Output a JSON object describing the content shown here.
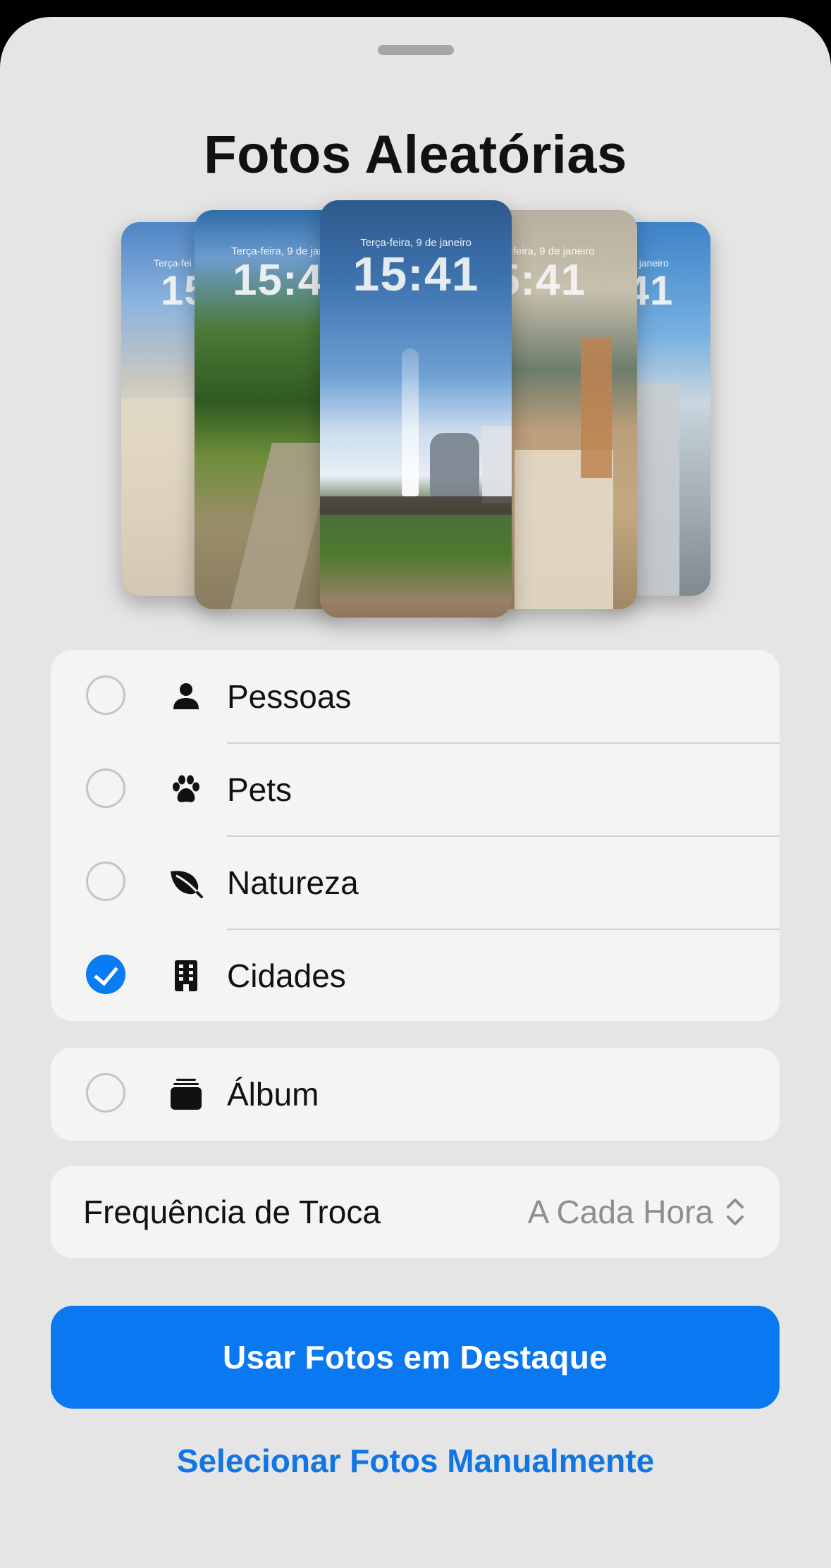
{
  "title": "Fotos Aleatórias",
  "previews": {
    "date_partial_left": "Terça-fei",
    "date_left": "Terça-feira, 9 de janeir",
    "date_center": "Terça-feira, 9 de janeiro",
    "date_right": "a-feira, 9 de janeiro",
    "date_far_right": "de janeiro",
    "time_far_left": "15",
    "time_left": "15:4",
    "time_center": "15:41",
    "time_right": "5:41",
    "time_far_right": "41"
  },
  "categories": [
    {
      "label": "Pessoas",
      "icon": "person-icon",
      "selected": false
    },
    {
      "label": "Pets",
      "icon": "paw-icon",
      "selected": false
    },
    {
      "label": "Natureza",
      "icon": "leaf-icon",
      "selected": false
    },
    {
      "label": "Cidades",
      "icon": "building-icon",
      "selected": true
    }
  ],
  "album": {
    "label": "Álbum",
    "icon": "album-stack-icon",
    "selected": false
  },
  "frequency": {
    "label": "Frequência de Troca",
    "value": "A Cada Hora"
  },
  "primary_button": "Usar Fotos em Destaque",
  "secondary_button": "Selecionar Fotos Manualmente",
  "colors": {
    "accent": "#0a78f0",
    "link": "#1175e4",
    "background": "#e5e5e6",
    "group": "#f4f4f4"
  }
}
